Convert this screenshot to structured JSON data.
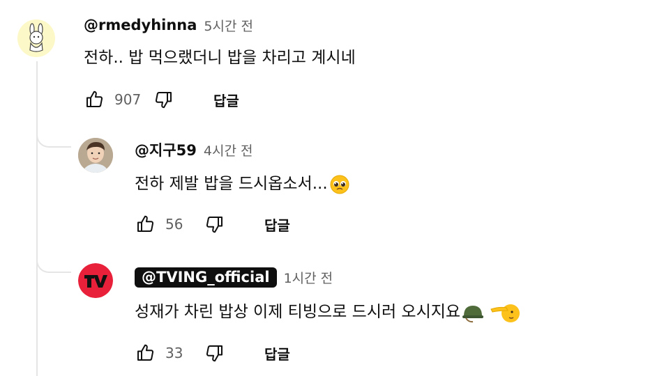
{
  "comments": [
    {
      "author": "@rmedyhinna",
      "time": "5시간 전",
      "text": "전하.. 밥 먹으랬더니 밥을 차리고 계시네",
      "likes": "907",
      "reply_label": "답글",
      "avatar_icon": "cartoon-rabbit-avatar"
    },
    {
      "author": "@지구59",
      "time": "4시간 전",
      "text": "전하 제발 밥을 드시옵소서...",
      "emoji": "pleading-face-emoji",
      "likes": "56",
      "reply_label": "답글",
      "avatar_icon": "person-photo-avatar"
    },
    {
      "author": "@TVING_official",
      "time": "1시간 전",
      "text": "성재가 차린 밥상 이제 티빙으로 드시러 오시지요",
      "emojis": [
        "military-helmet-emoji",
        "saluting-face-emoji"
      ],
      "likes": "33",
      "reply_label": "답글",
      "avatar_icon": "tving-logo-avatar",
      "brand_color": "#e8203a"
    }
  ]
}
